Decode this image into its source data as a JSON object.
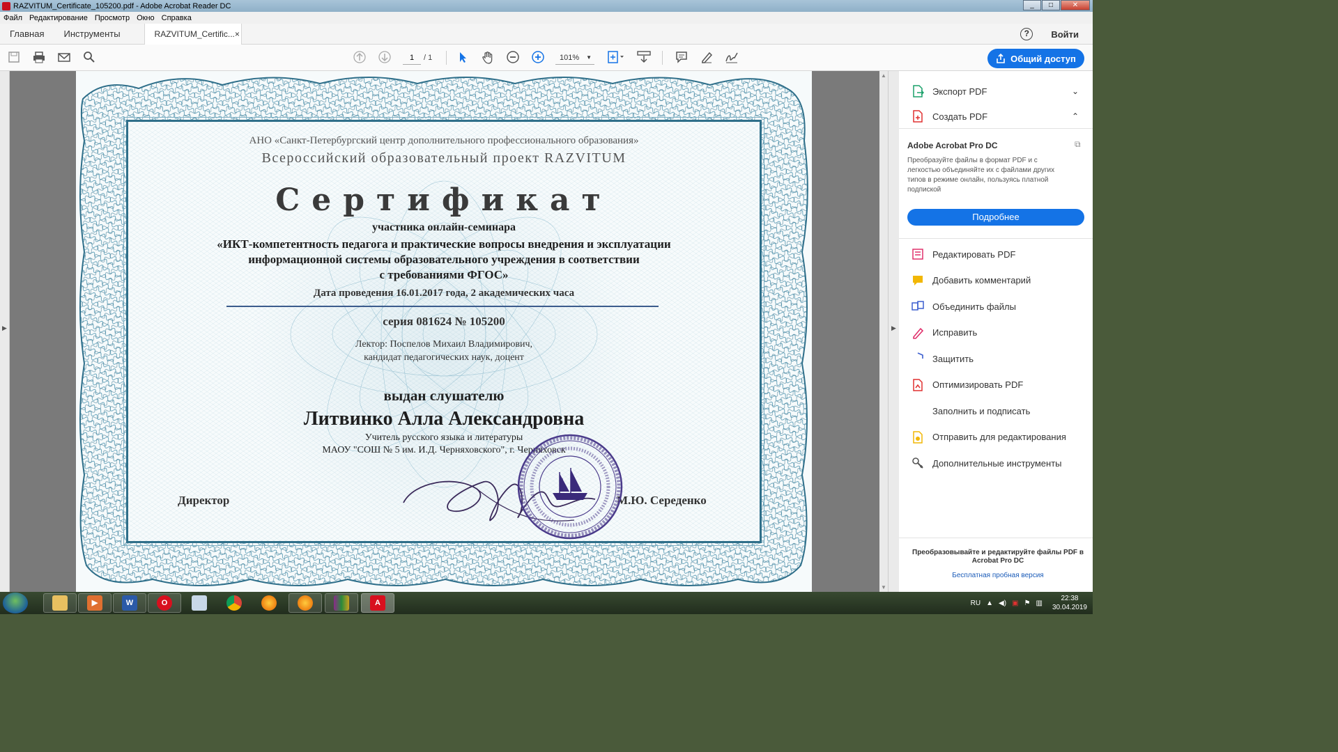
{
  "window": {
    "title": "RAZVITUM_Certificate_105200.pdf - Adobe Acrobat Reader DC",
    "controls": [
      "_",
      "□",
      "✕"
    ]
  },
  "menu": [
    "Файл",
    "Редактирование",
    "Просмотр",
    "Окно",
    "Справка"
  ],
  "tabs": {
    "home": "Главная",
    "tools": "Инструменты",
    "document": "RAZVITUM_Certific...",
    "close": "×",
    "help": "?",
    "signin": "Войти"
  },
  "toolbar": {
    "page_current": "1",
    "page_total": "/ 1",
    "zoom": "101%",
    "share_label": "Общий доступ"
  },
  "certificate": {
    "org": "АНО «Санкт-Петербургский центр дополнительного профессионального образования»",
    "project": "Всероссийский образовательный проект RAZVITUM",
    "title": "Сертификат",
    "participant": "участника онлайн-семинара",
    "seminar_line1": "«ИКТ-компетентность педагога и практические вопросы внедрения и эксплуатации",
    "seminar_line2": "информационной системы образовательного учреждения в соответствии",
    "seminar_line3": "с требованиями ФГОС»",
    "date": "Дата проведения 16.01.2017 года, 2 академических часа",
    "serial": "серия 081624 № 105200",
    "lecturer_line1": "Лектор: Поспелов Михаил Владимирович,",
    "lecturer_line2": "кандидат педагогических наук, доцент",
    "issued": "выдан слушателю",
    "name": "Литвинко Алла Александровна",
    "position_line1": "Учитель русского языка и литературы",
    "position_line2": "МАОУ \"СОШ № 5 им. И.Д. Черняховского\", г. Черняховск",
    "director_label": "Директор",
    "director_name": "М.Ю. Середенко"
  },
  "right_panel": {
    "export_pdf": "Экспорт PDF",
    "create_pdf": "Создать PDF",
    "promo_title": "Adobe Acrobat Pro DC",
    "promo_desc": "Преобразуйте файлы в формат PDF и с легкостью объединяйте их с файлами других типов в режиме онлайн, пользуясь платной подпиской",
    "more_button": "Подробнее",
    "tools": [
      {
        "label": "Редактировать PDF",
        "icon": "edit-pdf-icon",
        "color": "#e0306c"
      },
      {
        "label": "Добавить комментарий",
        "icon": "comment-icon",
        "color": "#f2b705"
      },
      {
        "label": "Объединить файлы",
        "icon": "combine-icon",
        "color": "#3c5fcf"
      },
      {
        "label": "Исправить",
        "icon": "fix-icon",
        "color": "#e0306c"
      },
      {
        "label": "Защитить",
        "icon": "shield-icon",
        "color": "#3c5fcf"
      },
      {
        "label": "Оптимизировать PDF",
        "icon": "optimize-icon",
        "color": "#e03030"
      },
      {
        "label": "Заполнить и подписать",
        "icon": "fill-sign-icon",
        "color": "#8a3fcf"
      },
      {
        "label": "Отправить для редактирования",
        "icon": "send-review-icon",
        "color": "#f2b705"
      },
      {
        "label": "Дополнительные инструменты",
        "icon": "more-tools-icon",
        "color": "#555555"
      }
    ],
    "footer_promo": "Преобразовывайте и редактируйте файлы PDF в Acrobat Pro DC",
    "footer_link": "Бесплатная пробная версия"
  },
  "taskbar": {
    "language": "RU",
    "time": "22:38",
    "date": "30.04.2019"
  },
  "colors": {
    "accent": "#1473e6",
    "frame": "#2f6f8a",
    "seal": "#4a3a8a"
  }
}
